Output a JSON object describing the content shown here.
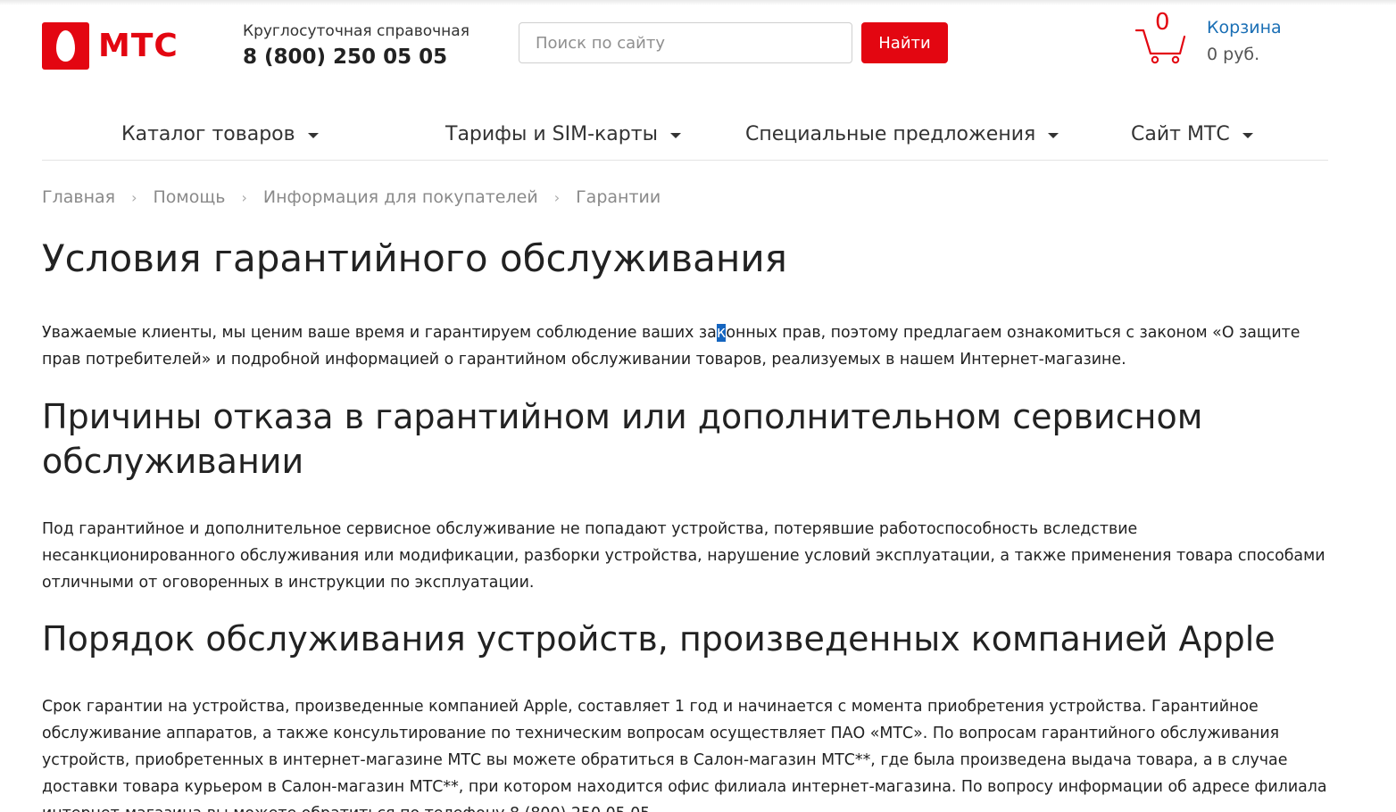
{
  "header": {
    "logo_text": "МТС",
    "hotline_label": "Круглосуточная справочная",
    "hotline_phone": "8 (800) 250 05 05",
    "search_placeholder": "Поиск по сайту",
    "search_button": "Найти",
    "cart": {
      "count": "0",
      "title": "Корзина",
      "sum": "0 руб."
    }
  },
  "nav": {
    "items": [
      {
        "label": "Каталог товаров"
      },
      {
        "label": "Тарифы и SIM-карты"
      },
      {
        "label": "Специальные предложения"
      },
      {
        "label": "Сайт МТС"
      }
    ]
  },
  "breadcrumb": {
    "items": [
      "Главная",
      "Помощь",
      "Информация для покупателей",
      "Гарантии"
    ],
    "separator": "›"
  },
  "content": {
    "title": "Условия гарантийного обслуживания",
    "intro_part1": "Уважаемые клиенты, мы ценим ваше время и гарантируем соблюдение ваших за",
    "intro_highlight": "к",
    "intro_part2": "онных прав, поэтому предлагаем ознакомиться с законом «О защите прав потребителей» и подробной информацией о гарантийном обслуживании товаров, реализуемых в нашем Интернет-магазине.",
    "section1_title": "Причины отказа в гарантийном или дополнительном сервисном обслуживании",
    "section1_text": "Под гарантийное и дополнительное сервисное обслуживание не попадают устройства, потерявшие работоспособность вследствие несанкционированного обслуживания или модификации, разборки устройства, нарушение условий эксплуатации, а также применения товара способами отличными от оговоренных в инструкции по эксплуатации.",
    "section2_title": "Порядок обслуживания устройств, произведенных компанией Apple",
    "section2_text": "Срок гарантии на устройства, произведенные компанией Apple, составляет 1 год и начинается с момента приобретения устройства. Гарантийное обслуживание аппаратов, а также консультирование по техническим вопросам осуществляет ПАО «МТС». По вопросам гарантийного обслуживания устройств, приобретенных в интернет-магазине МТС вы можете обратиться в Салон-магазин МТС**, где была произведена выдача товара, а в случае доставки товара курьером в Салон-магазин МТС**, при котором находится офис филиала интернет-магазина. По вопросу информации об адресе филиала интернет-магазина вы можете обратиться по телефону 8 (800) 250 05 05"
  },
  "colors": {
    "brand_red": "#e30611",
    "link_blue": "#1a6fb5",
    "selection_blue": "#1565c0"
  },
  "icons": [
    "mts-egg-logo",
    "cart-icon",
    "chevron-down-icon"
  ]
}
